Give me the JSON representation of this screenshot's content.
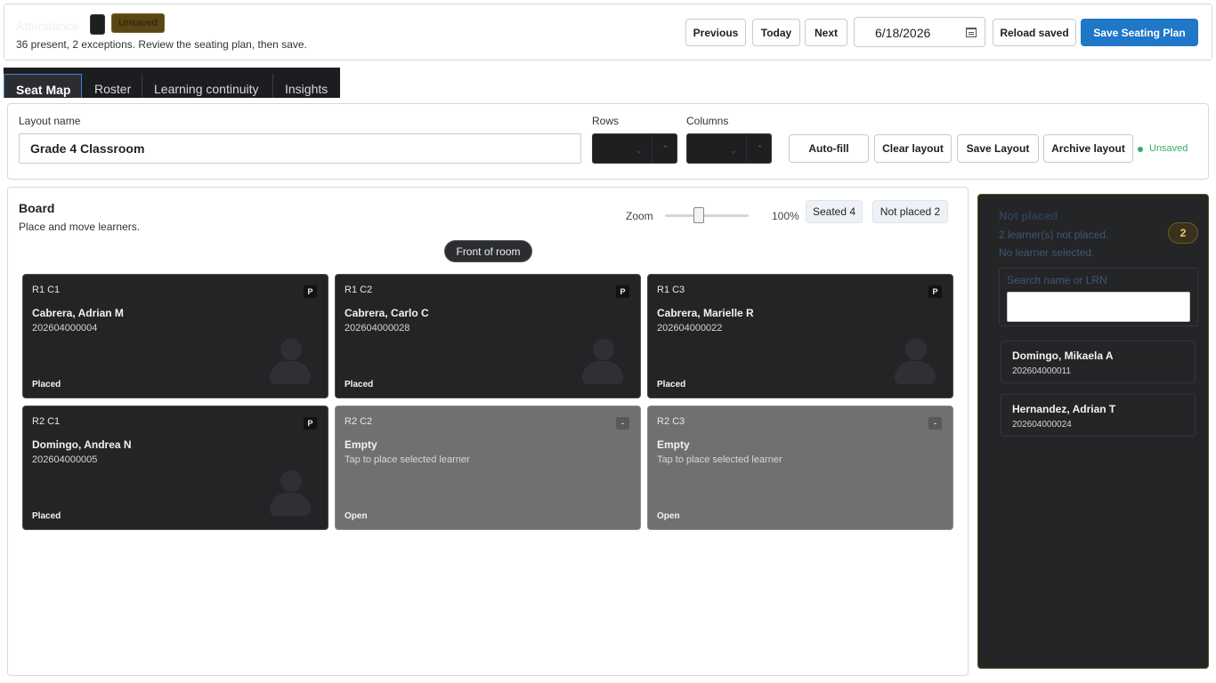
{
  "header": {
    "title": "Attendance",
    "status_pill": "Unsaved",
    "subtitle": "36 present, 2 exceptions. Review the seating plan, then save.",
    "previous_label": "Previous",
    "today_label": "Today",
    "next_label": "Next",
    "date_value": "6/18/2026",
    "reload_label": "Reload saved",
    "save_plan_label": "Save Seating Plan"
  },
  "tabs": [
    {
      "label": "Seat Map",
      "active": true
    },
    {
      "label": "Roster",
      "active": false
    },
    {
      "label": "Learning continuity",
      "active": false
    },
    {
      "label": "Insights",
      "active": false
    }
  ],
  "layout": {
    "name_label": "Layout name",
    "name_value": "Grade 4 Classroom",
    "rows_label": "Rows",
    "columns_label": "Columns",
    "autofill_label": "Auto-fill",
    "clear_label": "Clear layout",
    "save_label": "Save Layout",
    "archive_label": "Archive layout",
    "status": "Unsaved",
    "accent_color": "#1f77c8",
    "status_color": "#3aa86b"
  },
  "board": {
    "title": "Board",
    "subtitle": "Place and move learners.",
    "zoom_label": "Zoom",
    "zoom_value": "100%",
    "zoom_fraction": 0.4,
    "seated_chip": "Seated 4",
    "not_placed_chip": "Not placed 2",
    "front_label": "Front of room",
    "seats": [
      {
        "pos": "R1 C1",
        "badge": "P",
        "name": "Cabrera, Adrian M",
        "lrn": "202604000004",
        "status": "Placed",
        "filled": true
      },
      {
        "pos": "R1 C2",
        "badge": "P",
        "name": "Cabrera, Carlo C",
        "lrn": "202604000028",
        "status": "Placed",
        "filled": true
      },
      {
        "pos": "R1 C3",
        "badge": "P",
        "name": "Cabrera, Marielle R",
        "lrn": "202604000022",
        "status": "Placed",
        "filled": true
      },
      {
        "pos": "R2 C1",
        "badge": "P",
        "name": "Domingo, Andrea N",
        "lrn": "202604000005",
        "status": "Placed",
        "filled": true
      },
      {
        "pos": "R2 C2",
        "badge": "-",
        "name": "Empty",
        "lrn": "Tap to place selected learner",
        "status": "Open",
        "filled": false
      },
      {
        "pos": "R2 C3",
        "badge": "-",
        "name": "Empty",
        "lrn": "Tap to place selected learner",
        "status": "Open",
        "filled": false
      }
    ]
  },
  "not_placed": {
    "title": "Not placed",
    "count": "2",
    "summary": "2 learner(s) not placed.",
    "selection": "No learner selected.",
    "search_label": "Search name or LRN",
    "search_value": "",
    "items": [
      {
        "name": "Domingo, Mikaela A",
        "lrn": "202604000011"
      },
      {
        "name": "Hernandez, Adrian T",
        "lrn": "202604000024"
      }
    ]
  }
}
